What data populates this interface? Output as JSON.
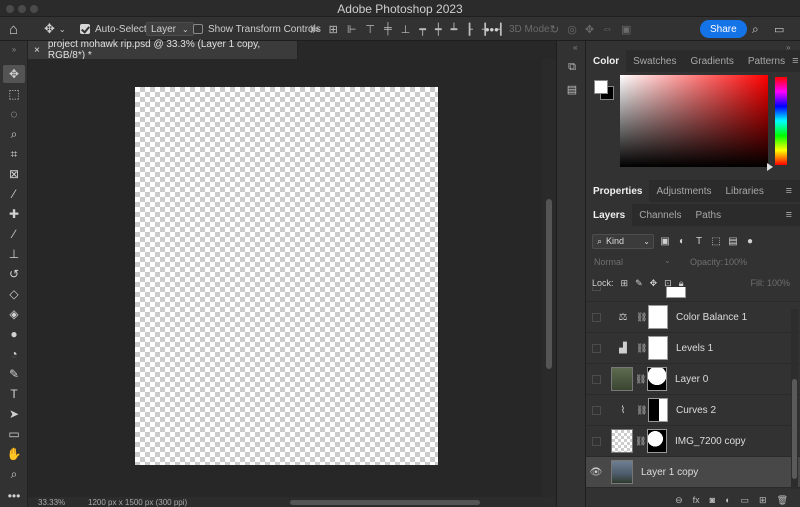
{
  "app": {
    "title": "Adobe Photoshop 2023"
  },
  "options_bar": {
    "auto_select_label": "Auto-Select:",
    "auto_select_checked": true,
    "auto_select_value": "Layer",
    "show_transform_label": "Show Transform Controls",
    "show_transform_checked": false,
    "mode_3d_label": "3D Mode:",
    "share_label": "Share"
  },
  "document": {
    "tab_title": "project mohawk rip.psd @ 33.3% (Layer 1 copy, RGB/8*) *",
    "close_glyph": "×"
  },
  "status": {
    "zoom": "33.33%",
    "doc_info": "1200 px x 1500 px (300 ppi)"
  },
  "tools": [
    {
      "name": "move-tool",
      "glyph": "✥",
      "active": true
    },
    {
      "name": "marquee-tool",
      "glyph": "⬚"
    },
    {
      "name": "lasso-tool",
      "glyph": "◌"
    },
    {
      "name": "quick-select-tool",
      "glyph": "⌕"
    },
    {
      "name": "crop-tool",
      "glyph": "⌗"
    },
    {
      "name": "frame-tool",
      "glyph": "⊠"
    },
    {
      "name": "eyedropper-tool",
      "glyph": "⁄"
    },
    {
      "name": "healing-brush-tool",
      "glyph": "✚"
    },
    {
      "name": "brush-tool",
      "glyph": "∕"
    },
    {
      "name": "clone-stamp-tool",
      "glyph": "⊥"
    },
    {
      "name": "history-brush-tool",
      "glyph": "↺"
    },
    {
      "name": "eraser-tool",
      "glyph": "◇"
    },
    {
      "name": "paint-bucket-tool",
      "glyph": "◈"
    },
    {
      "name": "blur-tool",
      "glyph": "●"
    },
    {
      "name": "dodge-tool",
      "glyph": "◔"
    },
    {
      "name": "pen-tool",
      "glyph": "✎"
    },
    {
      "name": "type-tool",
      "glyph": "T"
    },
    {
      "name": "path-select-tool",
      "glyph": "➤"
    },
    {
      "name": "rectangle-tool",
      "glyph": "▭"
    },
    {
      "name": "hand-tool",
      "glyph": "✋"
    },
    {
      "name": "zoom-tool",
      "glyph": "⌕"
    },
    {
      "name": "more-tools",
      "glyph": "•••"
    }
  ],
  "color_panel": {
    "tabs": [
      "Color",
      "Swatches",
      "Gradients",
      "Patterns"
    ],
    "active_tab": "Color",
    "foreground": "#ffffff",
    "background": "#000000"
  },
  "properties_panel": {
    "tabs": [
      "Properties",
      "Adjustments",
      "Libraries"
    ],
    "active_tab": "Properties"
  },
  "layers_panel": {
    "tabs": [
      "Layers",
      "Channels",
      "Paths"
    ],
    "active_tab": "Layers",
    "filter_kind": "Kind",
    "blend_mode": "Normal",
    "opacity_label": "Opacity:",
    "opacity_value": "100%",
    "lock_label": "Lock:",
    "fill_label": "Fill:",
    "fill_value": "100%",
    "layers": [
      {
        "name": "",
        "type": "partial",
        "icon": "",
        "visible": false
      },
      {
        "name": "Color Balance 1",
        "type": "adjustment",
        "icon": "balance-icon",
        "glyph": "⚖",
        "visible": false
      },
      {
        "name": "Levels 1",
        "type": "adjustment",
        "icon": "levels-icon",
        "glyph": "▟",
        "visible": false
      },
      {
        "name": "Layer 0",
        "type": "smart",
        "icon": "",
        "visible": false
      },
      {
        "name": "Curves 2",
        "type": "adjustment",
        "icon": "curves-icon",
        "glyph": "⌇",
        "visible": false
      },
      {
        "name": "IMG_7200 copy",
        "type": "pixel",
        "icon": "",
        "visible": false
      },
      {
        "name": "Layer 1 copy",
        "type": "pixel",
        "icon": "",
        "visible": true,
        "selected": true
      }
    ]
  }
}
